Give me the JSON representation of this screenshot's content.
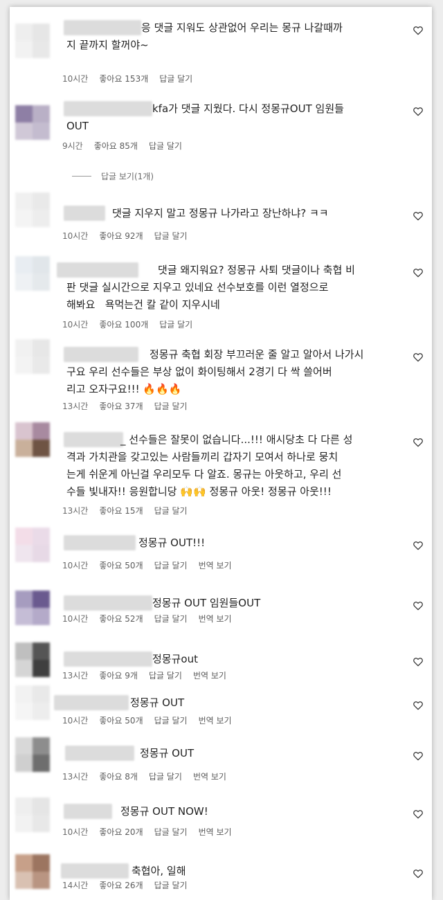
{
  "heart_icon": "heart-outline-icon",
  "colors": {
    "text": "#1f1f1f",
    "meta": "#6a6a6a",
    "background": "#ffffff",
    "emoji_fire": "#e0891c",
    "emoji_hands": "#e9c64a"
  },
  "view_replies": "답글 보기(1개)",
  "comments": [
    {
      "text": "응 댓글 지워도 상관없어 우리는 몽규 나갈때까\n지 끝까지 할꺼야~",
      "time": "10시간",
      "likes": "좋아요 153개",
      "reply": "답글 달기",
      "translate": ""
    },
    {
      "text": "kfa가 댓글 지웠다. 다시 정몽규OUT 임원들\nOUT",
      "time": "9시간",
      "likes": "좋아요 85개",
      "reply": "답글 달기",
      "translate": ""
    },
    {
      "text": "댓글 지우지 말고 정몽규 나가라고 장난하냐? ㅋㅋ",
      "time": "10시간",
      "likes": "좋아요 92개",
      "reply": "답글 달기",
      "translate": ""
    },
    {
      "text": "댓글 왜지워요? 정몽규 사퇴 댓글이나 축협 비\n판 댓글 실시간으로 지우고 있네요 선수보호를 이런 열정으로\n해봐요   욕먹는건 칼 같이 지우시네",
      "time": "10시간",
      "likes": "좋아요 100개",
      "reply": "답글 달기",
      "translate": ""
    },
    {
      "text": "정몽규 축협 회장 부끄러운 줄 알고 알아서 나가시\n구요 우리 선수들은 부상 없이 화이팅해서 2경기 다 싹 쓸어버\n리고 오자구요!!!",
      "emoji": "🔥🔥🔥",
      "time": "13시간",
      "likes": "좋아요 37개",
      "reply": "답글 달기",
      "translate": ""
    },
    {
      "text": "_ 선수들은 잘못이 없습니다...!!! 애시당초 다 다른 성\n격과 가치관을 갖고있는 사람들끼리 갑자기 모여서 하나로 뭉치\n는게 쉬운게 아닌걸 우리모두 다 알죠. 몽규는 아웃하고, 우리 선\n수들 빛내자!! 응원합니당",
      "emoji2": "🙌🙌",
      "text_after": " 정몽규 아웃! 정몽규 아웃!!!",
      "time": "13시간",
      "likes": "좋아요 15개",
      "reply": "답글 달기",
      "translate": ""
    },
    {
      "text": "정몽규 OUT!!!",
      "time": "10시간",
      "likes": "좋아요 50개",
      "reply": "답글 달기",
      "translate": "번역 보기"
    },
    {
      "text": "정몽규 OUT 임원들OUT",
      "time": "10시간",
      "likes": "좋아요 52개",
      "reply": "답글 달기",
      "translate": "번역 보기"
    },
    {
      "text": "정몽규out",
      "time": "13시간",
      "likes": "좋아요 9개",
      "reply": "답글 달기",
      "translate": "번역 보기"
    },
    {
      "text": "정몽규 OUT",
      "time": "10시간",
      "likes": "좋아요 50개",
      "reply": "답글 달기",
      "translate": "번역 보기"
    },
    {
      "text": "정몽규 OUT",
      "time": "13시간",
      "likes": "좋아요 8개",
      "reply": "답글 달기",
      "translate": "번역 보기"
    },
    {
      "text": "정몽규 OUT NOW!",
      "time": "10시간",
      "likes": "좋아요 20개",
      "reply": "답글 달기",
      "translate": "번역 보기"
    },
    {
      "text": "축협아, 일해",
      "time": "14시간",
      "likes": "좋아요 26개",
      "reply": "답글 달기",
      "translate": ""
    }
  ]
}
